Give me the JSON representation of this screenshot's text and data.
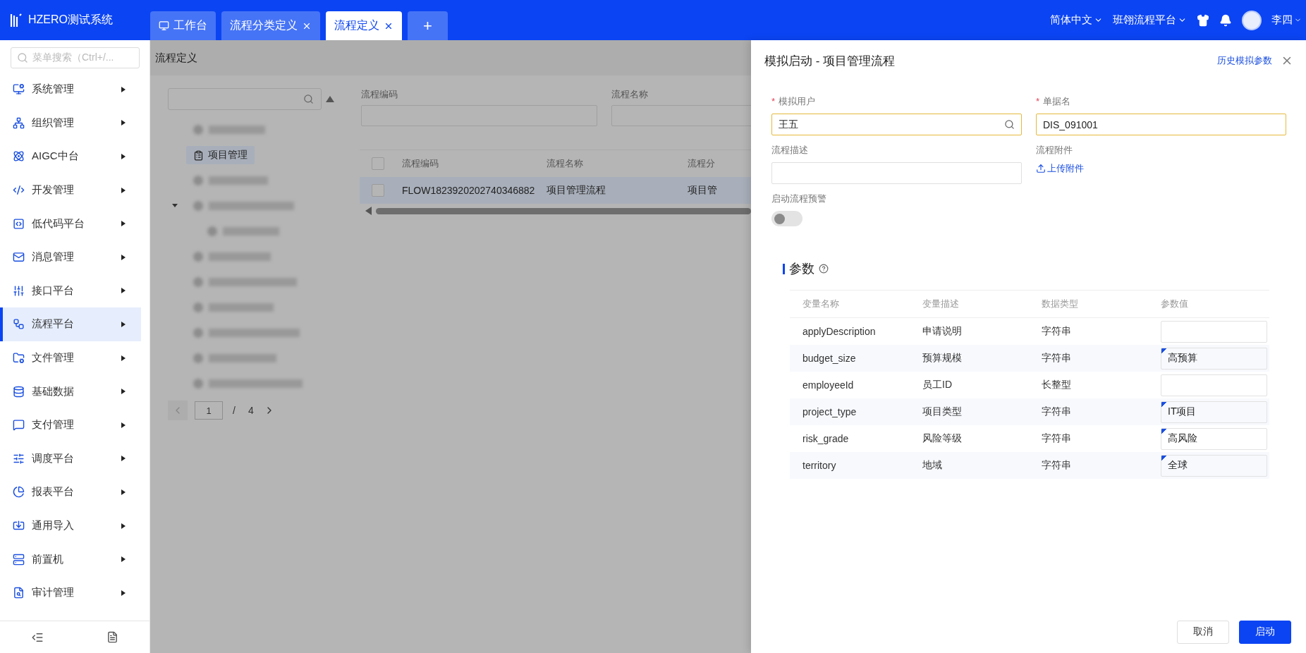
{
  "app": {
    "title": "HZERO测试系统"
  },
  "tabs": [
    {
      "label": "工作台",
      "kind": "home",
      "selected": false
    },
    {
      "label": "流程分类定义",
      "kind": "closable",
      "selected": false
    },
    {
      "label": "流程定义",
      "kind": "closable",
      "selected": true
    },
    {
      "label": "+",
      "kind": "add",
      "selected": false
    }
  ],
  "header_right": {
    "language": "简体中文",
    "platform": "班翎流程平台",
    "user": "李四"
  },
  "sidebar": {
    "search_placeholder": "菜单搜索（Ctrl+/...",
    "items": [
      {
        "label": "系统管理",
        "selected": false
      },
      {
        "label": "组织管理",
        "selected": false
      },
      {
        "label": "AIGC中台",
        "selected": false
      },
      {
        "label": "开发管理",
        "selected": false
      },
      {
        "label": "低代码平台",
        "selected": false
      },
      {
        "label": "消息管理",
        "selected": false
      },
      {
        "label": "接口平台",
        "selected": false
      },
      {
        "label": "流程平台",
        "selected": true
      },
      {
        "label": "文件管理",
        "selected": false
      },
      {
        "label": "基础数据",
        "selected": false
      },
      {
        "label": "支付管理",
        "selected": false
      },
      {
        "label": "调度平台",
        "selected": false
      },
      {
        "label": "报表平台",
        "selected": false
      },
      {
        "label": "通用导入",
        "selected": false
      },
      {
        "label": "前置机",
        "selected": false
      },
      {
        "label": "审计管理",
        "selected": false
      }
    ]
  },
  "page": {
    "title": "流程定义",
    "tree": {
      "items": [
        {
          "kind": "redacted",
          "selected": false
        },
        {
          "kind": "label",
          "label": "项目管理",
          "selected": true
        },
        {
          "kind": "redacted",
          "selected": false
        },
        {
          "kind": "redacted",
          "selected": false,
          "expanded": true,
          "children": [
            {
              "kind": "redacted",
              "selected": false
            }
          ]
        },
        {
          "kind": "redacted",
          "selected": false
        },
        {
          "kind": "redacted",
          "selected": false
        },
        {
          "kind": "redacted",
          "selected": false
        },
        {
          "kind": "redacted",
          "selected": false
        },
        {
          "kind": "redacted",
          "selected": false
        },
        {
          "kind": "redacted",
          "selected": false
        }
      ],
      "pagination": {
        "page": "1",
        "separator": "/",
        "total": "4"
      }
    },
    "filters": [
      {
        "label": "流程编码"
      },
      {
        "label": "流程名称"
      }
    ],
    "table": {
      "select_all_checked": false,
      "columns": [
        "流程编码",
        "流程名称",
        "流程分"
      ],
      "rows": [
        {
          "cells": [
            "FLOW1823920202740346882",
            "项目管理流程",
            "项目管"
          ],
          "selected": true,
          "checked": false
        }
      ]
    }
  },
  "drawer": {
    "title": "模拟启动 - 项目管理流程",
    "history_link": "历史模拟参数",
    "required_mark": "*",
    "fields": [
      {
        "kind": "search",
        "label": "模拟用户",
        "required": true,
        "value": "王五"
      },
      {
        "kind": "text",
        "label": "单据名",
        "required": true,
        "value": "DIS_091001"
      },
      {
        "kind": "text",
        "label": "流程描述",
        "required": false
      },
      {
        "kind": "upload",
        "label": "流程附件",
        "required": false,
        "action": "上传附件"
      },
      {
        "kind": "switch",
        "label": "启动流程预警",
        "required": false,
        "on": false
      }
    ],
    "params": {
      "title": "参数",
      "columns": [
        "变量名称",
        "变量描述",
        "数据类型",
        "参数值"
      ],
      "rows": [
        {
          "name": "applyDescription",
          "description": "申请说明",
          "type": "字符串",
          "changed": false
        },
        {
          "name": "budget_size",
          "description": "预算规模",
          "type": "字符串",
          "value": "高预算",
          "changed": true
        },
        {
          "name": "employeeId",
          "description": "员工ID",
          "type": "长整型",
          "changed": false
        },
        {
          "name": "project_type",
          "description": "项目类型",
          "type": "字符串",
          "value": "IT项目",
          "changed": true
        },
        {
          "name": "risk_grade",
          "description": "风险等级",
          "type": "字符串",
          "value": "高风险",
          "changed": true
        },
        {
          "name": "territory",
          "description": "地域",
          "type": "字符串",
          "value": "全球",
          "changed": true
        }
      ]
    },
    "buttons": [
      {
        "label": "取消",
        "kind": "default"
      },
      {
        "label": "启动",
        "kind": "primary"
      }
    ]
  }
}
